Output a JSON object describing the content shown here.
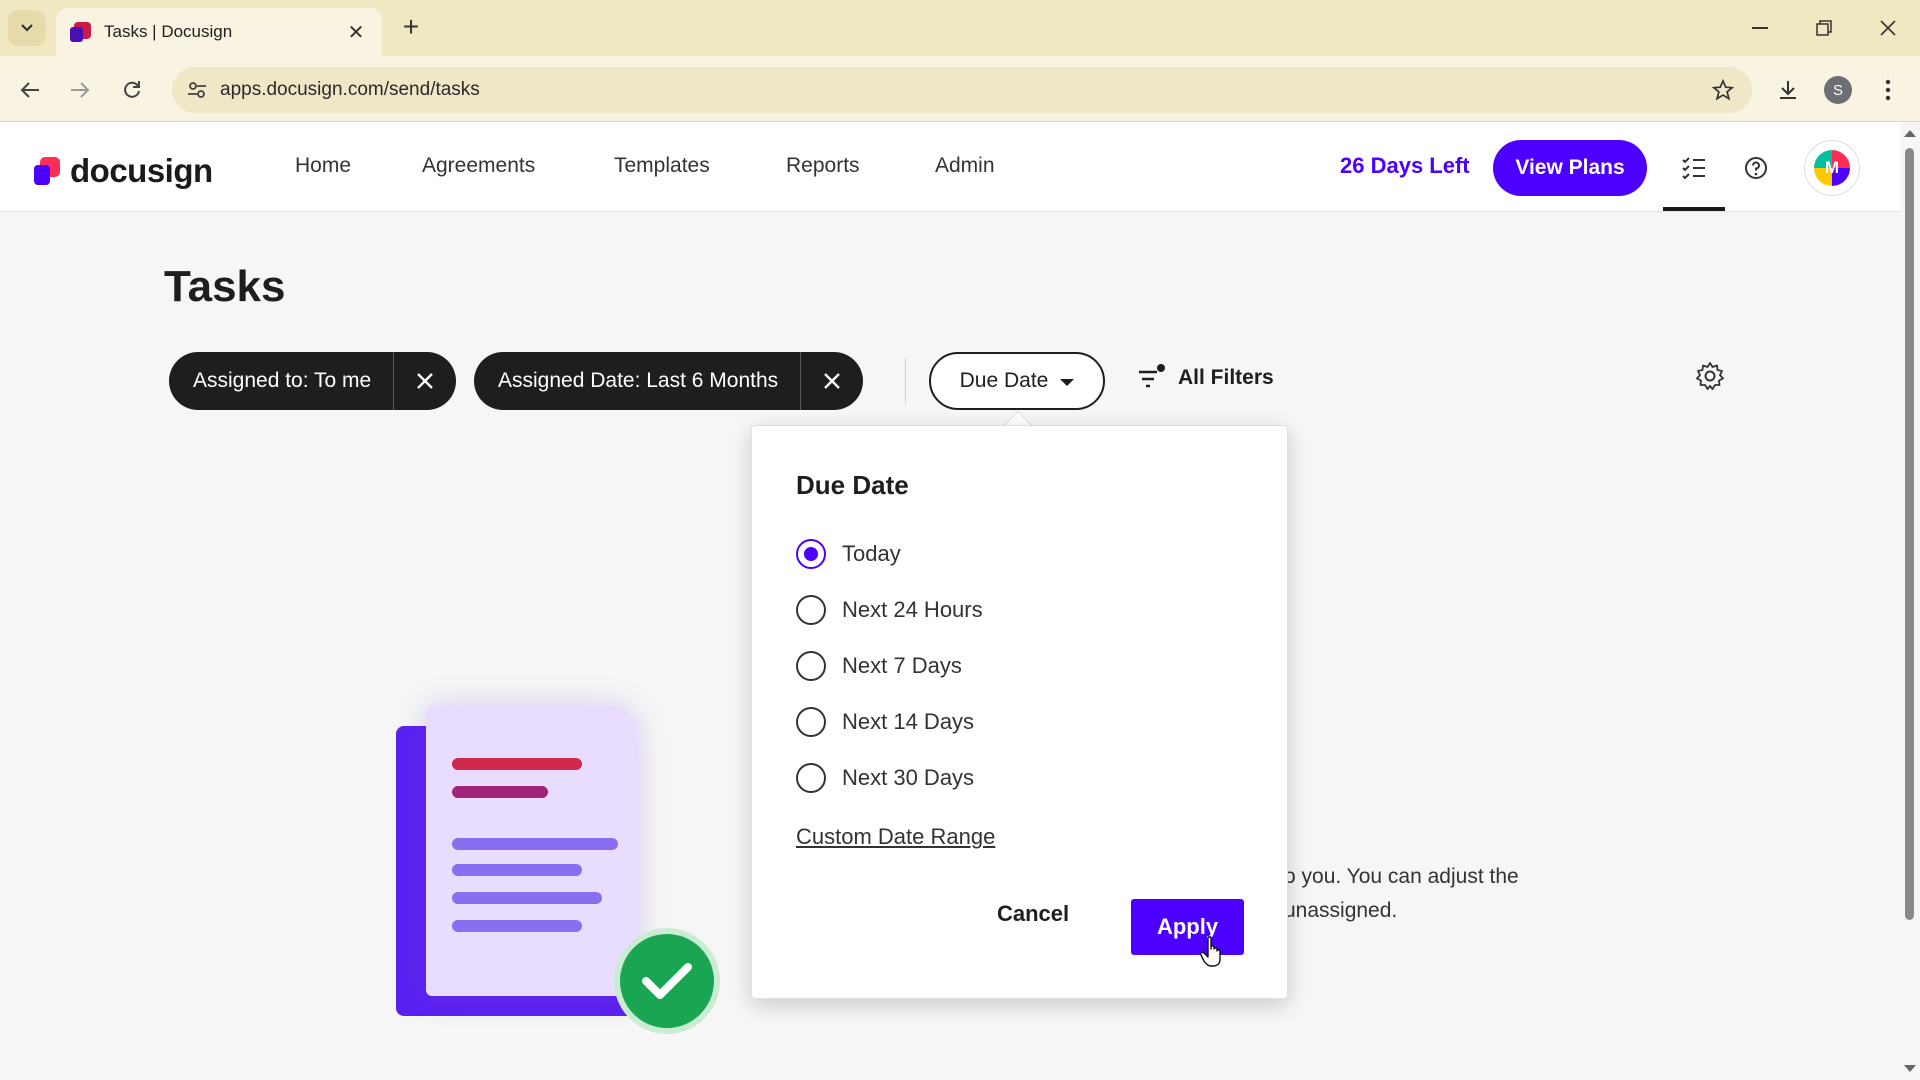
{
  "browser": {
    "tab_title": "Tasks | Docusign",
    "url": "apps.docusign.com/send/tasks",
    "profile_initial": "S"
  },
  "header": {
    "logo_text": "docusign",
    "nav": [
      "Home",
      "Agreements",
      "Templates",
      "Reports",
      "Admin"
    ],
    "trial_text": "26 Days Left",
    "view_plans": "View Plans",
    "avatar_initial": "M",
    "accent_color": "#4c00ff"
  },
  "page": {
    "title": "Tasks",
    "chips": [
      {
        "label": "Assigned to: To me"
      },
      {
        "label": "Assigned Date: Last 6 Months"
      }
    ],
    "due_date_button": "Due Date",
    "all_filters": "All Filters",
    "empty_text_line1": "o you. You can adjust the",
    "empty_text_line2": "unassigned."
  },
  "popover": {
    "title": "Due Date",
    "options": [
      {
        "label": "Today",
        "selected": true
      },
      {
        "label": "Next 24 Hours",
        "selected": false
      },
      {
        "label": "Next 7 Days",
        "selected": false
      },
      {
        "label": "Next 14 Days",
        "selected": false
      },
      {
        "label": "Next 30 Days",
        "selected": false
      }
    ],
    "custom_range": "Custom Date Range",
    "cancel": "Cancel",
    "apply": "Apply"
  },
  "icons": {
    "tab_list": "chevron-down-icon",
    "close": "close-icon",
    "new_tab": "plus-icon",
    "back": "back-arrow-icon",
    "forward": "forward-arrow-icon",
    "reload": "reload-icon",
    "bookmark": "star-icon",
    "download": "download-icon",
    "menu": "kebab-menu-icon",
    "tasks": "checklist-icon",
    "help": "help-icon",
    "filter": "filter-icon",
    "settings": "gear-icon"
  }
}
